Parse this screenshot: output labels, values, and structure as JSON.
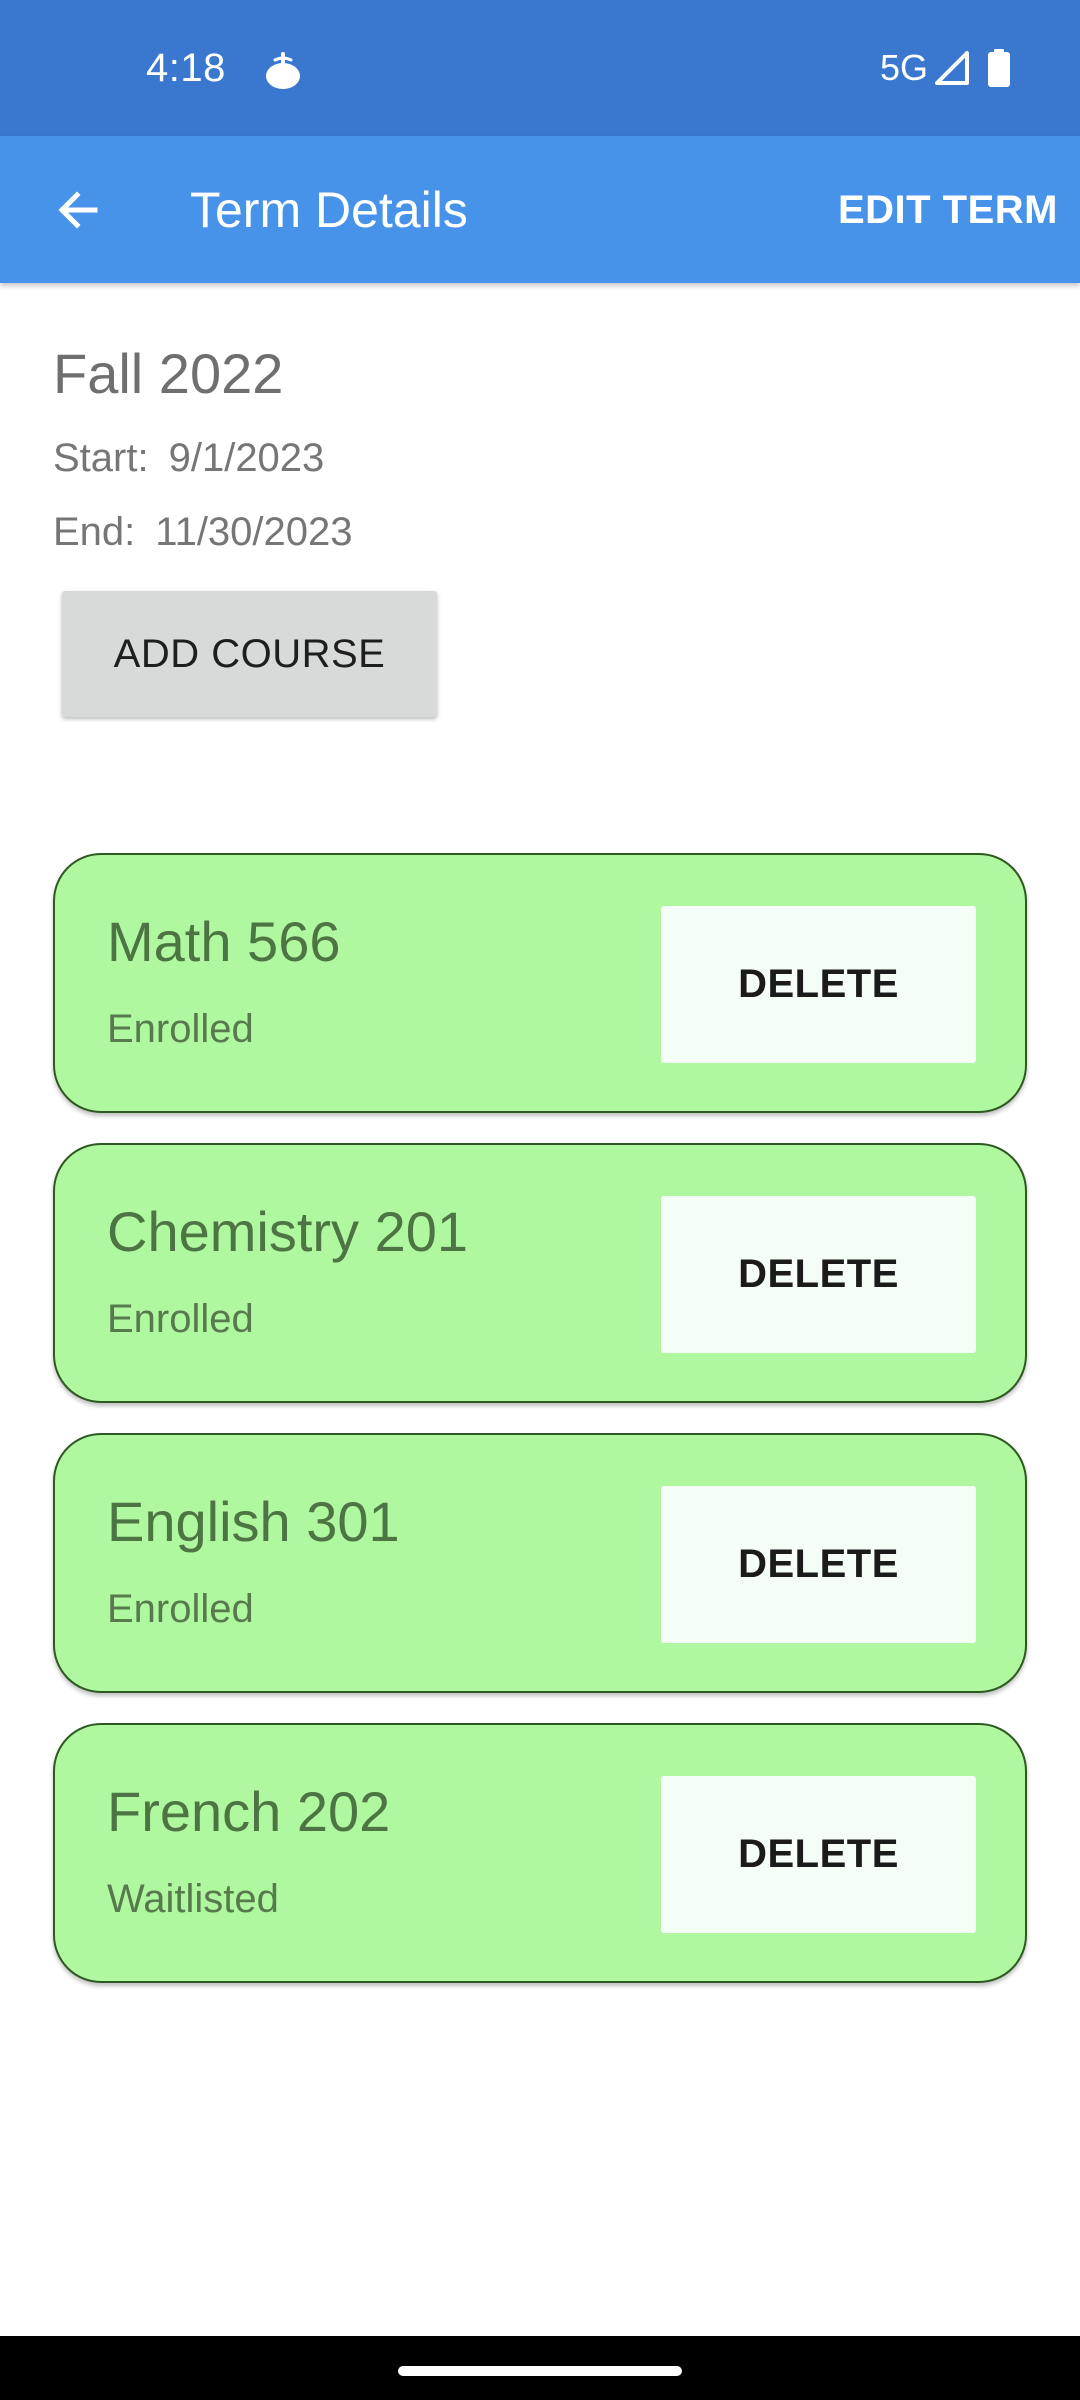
{
  "status_bar": {
    "time": "4:18",
    "app_icon": "tomato-icon",
    "network": "5G",
    "signal_icon": "signal-icon",
    "battery_icon": "battery-icon"
  },
  "app_bar": {
    "back_icon": "arrow-back-icon",
    "title": "Term Details",
    "edit_label": "EDIT TERM",
    "color": "#4793ea"
  },
  "term": {
    "name": "Fall 2022",
    "start_label": "Start:",
    "start_date": "9/1/2023",
    "end_label": "End:",
    "end_date": "11/30/2023",
    "add_course_label": "ADD COURSE"
  },
  "courses": [
    {
      "name": "Math 566",
      "status": "Enrolled",
      "delete_label": "DELETE"
    },
    {
      "name": "Chemistry 201",
      "status": "Enrolled",
      "delete_label": "DELETE"
    },
    {
      "name": "English 301",
      "status": "Enrolled",
      "delete_label": "DELETE"
    },
    {
      "name": "French 202",
      "status": "Waitlisted",
      "delete_label": "DELETE"
    }
  ],
  "colors": {
    "status_bar": "#3a78cf",
    "course_card": "#b0f8a0",
    "course_border": "#2e5a22",
    "add_course_button": "#d8d9d9"
  }
}
